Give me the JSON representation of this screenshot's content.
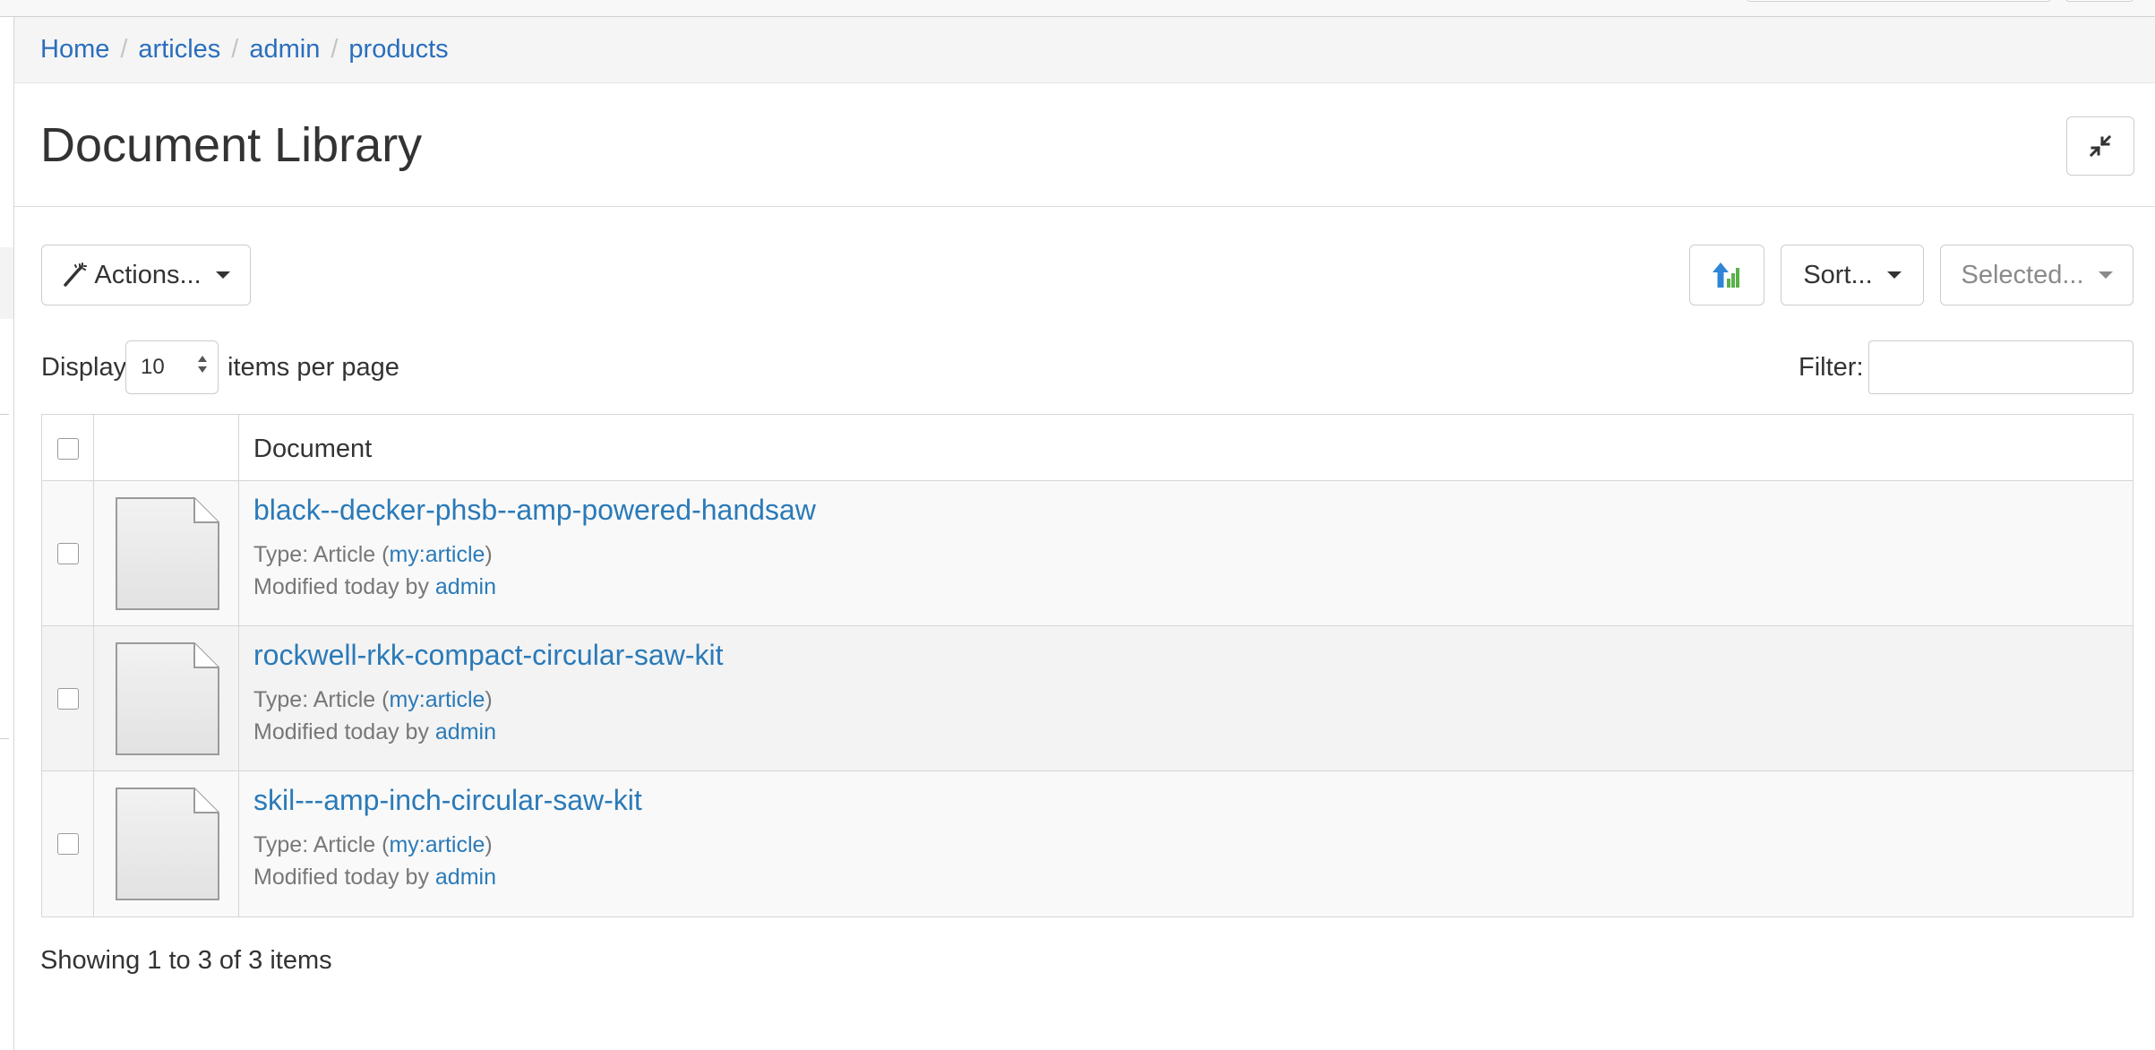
{
  "breadcrumb": {
    "items": [
      "Home",
      "articles",
      "admin",
      "products"
    ],
    "separator": "/"
  },
  "header": {
    "title": "Document Library",
    "collapse_icon": "compress-arrows-icon"
  },
  "toolbar": {
    "actions_label": "Actions...",
    "actions_icon": "magic-wand-icon",
    "upload_icon": "upload-arrow-icon",
    "sort_label": "Sort...",
    "selected_label": "Selected..."
  },
  "paging": {
    "display_label": "Display",
    "per_page_value": "10",
    "items_label": "items per page",
    "filter_label": "Filter:",
    "filter_value": ""
  },
  "table": {
    "column_document": "Document",
    "rows": [
      {
        "title": "black--decker-phsb--amp-powered-handsaw",
        "type_prefix": "Type: Article (",
        "type_link": "my:article",
        "type_suffix": ")",
        "modified_prefix": "Modified today by",
        "modified_user": "admin",
        "icon": "document-icon"
      },
      {
        "title": "rockwell-rkk-compact-circular-saw-kit",
        "type_prefix": "Type: Article (",
        "type_link": "my:article",
        "type_suffix": ")",
        "modified_prefix": "Modified today by",
        "modified_user": "admin",
        "icon": "document-icon"
      },
      {
        "title": "skil---amp-inch-circular-saw-kit",
        "type_prefix": "Type: Article (",
        "type_link": "my:article",
        "type_suffix": ")",
        "modified_prefix": "Modified today by",
        "modified_user": "admin",
        "icon": "document-icon"
      }
    ]
  },
  "footer": {
    "showing": "Showing 1 to 3 of 3 items"
  },
  "colors": {
    "link": "#2a7ab8",
    "breadcrumb_bg": "#f5f5f5",
    "row_alt": "#f3f3f3"
  }
}
